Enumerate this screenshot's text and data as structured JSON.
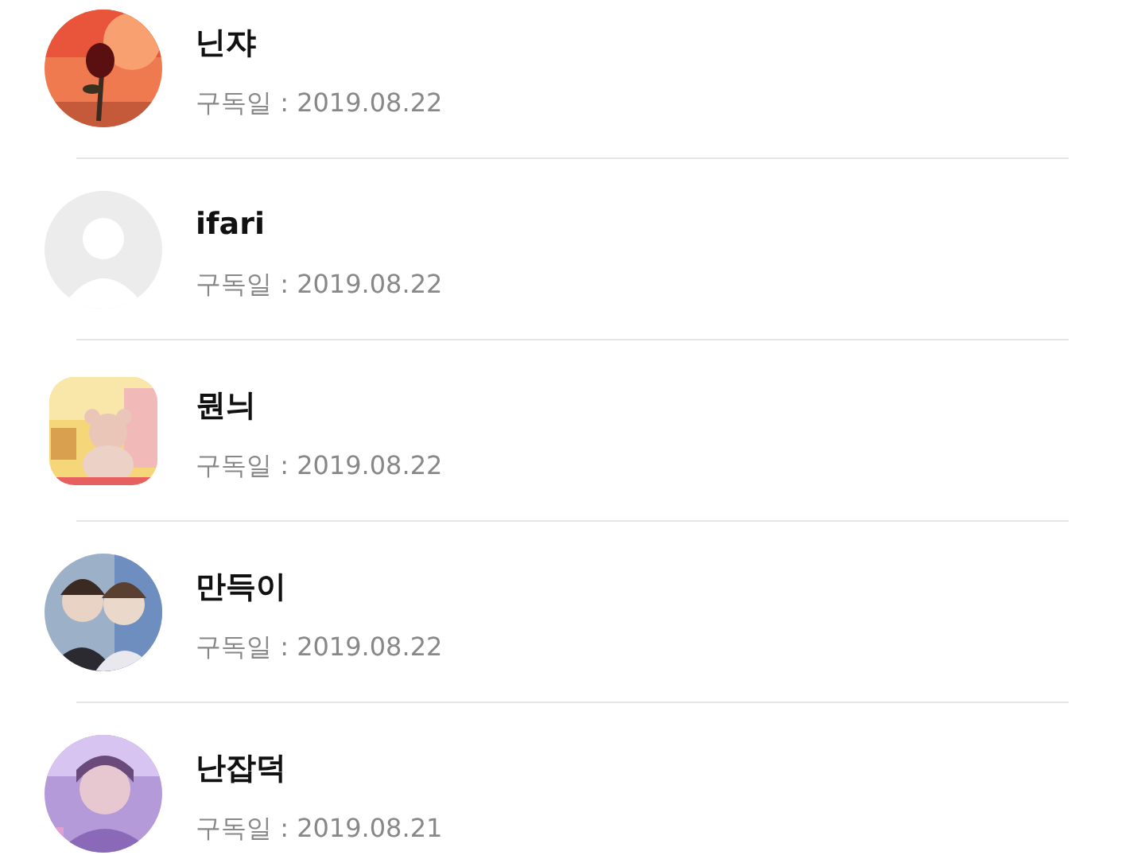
{
  "subscribers": [
    {
      "name": "닌쟈",
      "subscribed": "구독일 : 2019.08.22"
    },
    {
      "name": "ifari",
      "subscribed": "구독일 : 2019.08.22",
      "avatar": {
        "kind": "default"
      }
    },
    {
      "name": "뭔늬",
      "subscribed": "구독일 : 2019.08.22"
    },
    {
      "name": "만득이",
      "subscribed": "구독일 : 2019.08.22"
    },
    {
      "name": "난잡덕",
      "subscribed": "구독일 : 2019.08.21"
    }
  ]
}
